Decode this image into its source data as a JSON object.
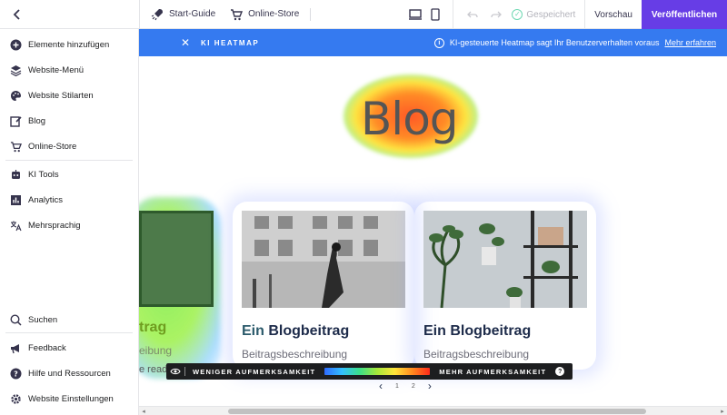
{
  "topbar": {
    "back_icon": "chevron-left-icon",
    "start_guide": "Start-Guide",
    "online_store": "Online-Store",
    "saved": "Gespeichert",
    "preview": "Vorschau",
    "publish": "Veröffentlichen"
  },
  "sidebar": {
    "items": [
      {
        "label": "Elemente hinzufügen",
        "icon": "plus-circle-icon"
      },
      {
        "label": "Website-Menü",
        "icon": "layers-icon"
      },
      {
        "label": "Website Stilarten",
        "icon": "palette-icon"
      },
      {
        "label": "Blog",
        "icon": "edit-icon"
      },
      {
        "label": "Online-Store",
        "icon": "cart-icon"
      },
      {
        "label": "KI Tools",
        "icon": "robot-icon"
      },
      {
        "label": "Analytics",
        "icon": "bar-chart-icon"
      },
      {
        "label": "Mehrsprachig",
        "icon": "translate-icon"
      },
      {
        "label": "Suchen",
        "icon": "search-icon"
      },
      {
        "label": "Feedback",
        "icon": "megaphone-icon"
      },
      {
        "label": "Hilfe und Ressourcen",
        "icon": "help-icon"
      },
      {
        "label": "Website Einstellungen",
        "icon": "gear-icon"
      }
    ]
  },
  "banner": {
    "tag": "KI HEATMAP",
    "info": "KI-gesteuerte Heatmap sagt Ihr Benutzerverhalten voraus",
    "link": "Mehr erfahren"
  },
  "page": {
    "title": "Blog",
    "card1_title": "trag",
    "card1_desc": "eibung",
    "card1_more": "e read",
    "cards": [
      {
        "title_a": "Ein",
        "title_b": " Blogbeitrag",
        "desc": "Beitragsbeschreibung"
      },
      {
        "title_a": "Ein",
        "title_b": " Blogbeitrag",
        "desc": "Beitragsbeschreibung"
      }
    ],
    "pager": {
      "p1": "1",
      "p2": "2"
    }
  },
  "legend": {
    "less": "WENIGER AUFMERKSAMKEIT",
    "more": "MEHR AUFMERKSAMKEIT"
  },
  "colors": {
    "accent": "#673de6",
    "banner": "#357af0"
  }
}
